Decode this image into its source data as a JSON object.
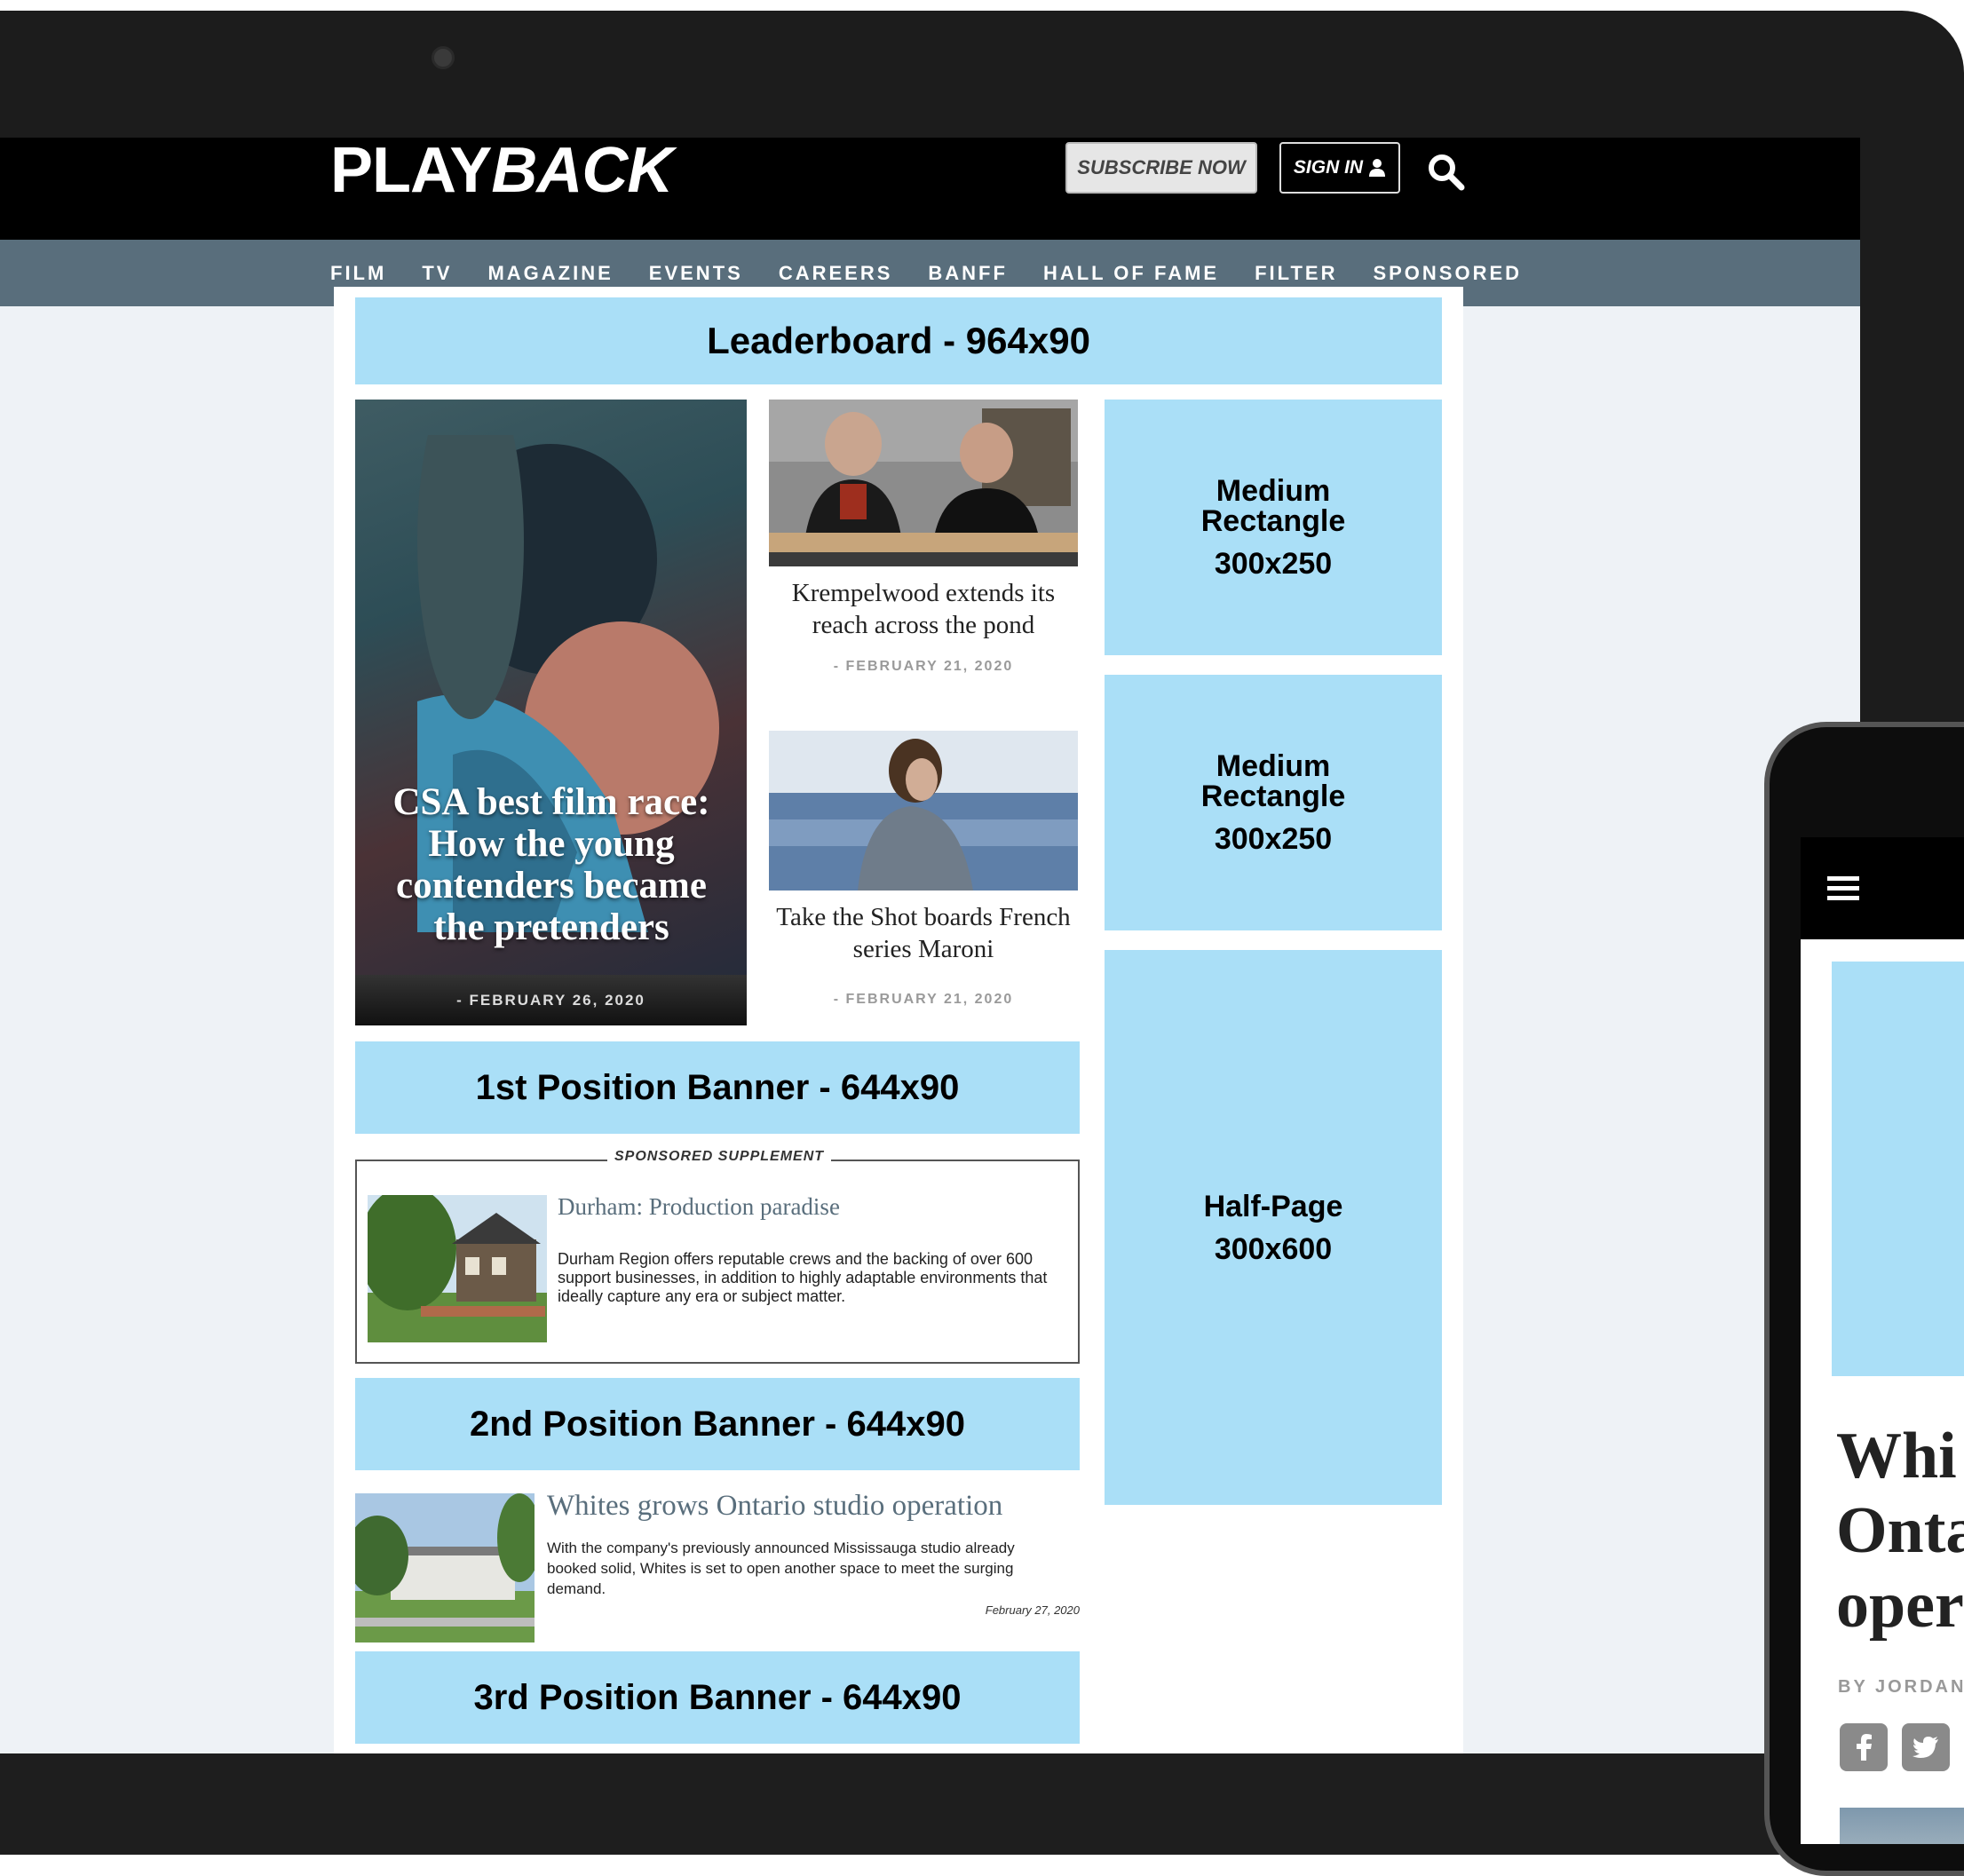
{
  "header": {
    "logo_play": "PLAY",
    "logo_back": "BACK",
    "subscribe_label": "SUBSCRIBE NOW",
    "signin_label": "SIGN IN"
  },
  "nav": {
    "items": [
      "FILM",
      "TV",
      "MAGAZINE",
      "EVENTS",
      "CAREERS",
      "BANFF",
      "HALL OF FAME",
      "FILTER",
      "SPONSORED"
    ]
  },
  "ads": {
    "leaderboard": "Leaderboard - 964x90",
    "mrect1_line1": "Medium",
    "mrect1_line2": "Rectangle",
    "mrect1_size": "300x250",
    "mrect2_line1": "Medium",
    "mrect2_line2": "Rectangle",
    "mrect2_size": "300x250",
    "halfpage_line1": "Half-Page",
    "halfpage_size": "300x600",
    "banner1": "1st Position Banner - 644x90",
    "banner2": "2nd Position Banner - 644x90",
    "banner3": "3rd Position Banner - 644x90"
  },
  "hero": {
    "title": "CSA best film race: How the young contenders became the pretenders",
    "date": "- FEBRUARY 26, 2020"
  },
  "cards": [
    {
      "title": "Krempelwood extends its reach across the pond",
      "date": "- FEBRUARY 21, 2020"
    },
    {
      "title": "Take the Shot boards French series Maroni",
      "date": "- FEBRUARY 21, 2020"
    }
  ],
  "sponsored": {
    "label": "SPONSORED SUPPLEMENT",
    "title": "Durham: Production paradise",
    "body": "Durham Region offers reputable crews and the backing of over 600 support businesses, in addition to highly adaptable environments that ideally capture any era or subject matter."
  },
  "article": {
    "title": "Whites grows Ontario studio operation",
    "body": "With the company's previously announced Mississauga studio already booked solid, Whites is set to open another space to meet the surging demand.",
    "date": "February 27, 2020"
  },
  "phone": {
    "title_line1": "Whi",
    "title_line2": "Onta",
    "title_line3": "oper",
    "byline": "BY JORDAN"
  },
  "colors": {
    "ad_fill": "#aadff7",
    "nav_bg": "#596e7c",
    "header_bg": "#000000",
    "page_bg": "#eef2f6"
  },
  "icons": [
    "search-icon",
    "user-icon",
    "menu-icon",
    "facebook-icon",
    "twitter-icon"
  ]
}
